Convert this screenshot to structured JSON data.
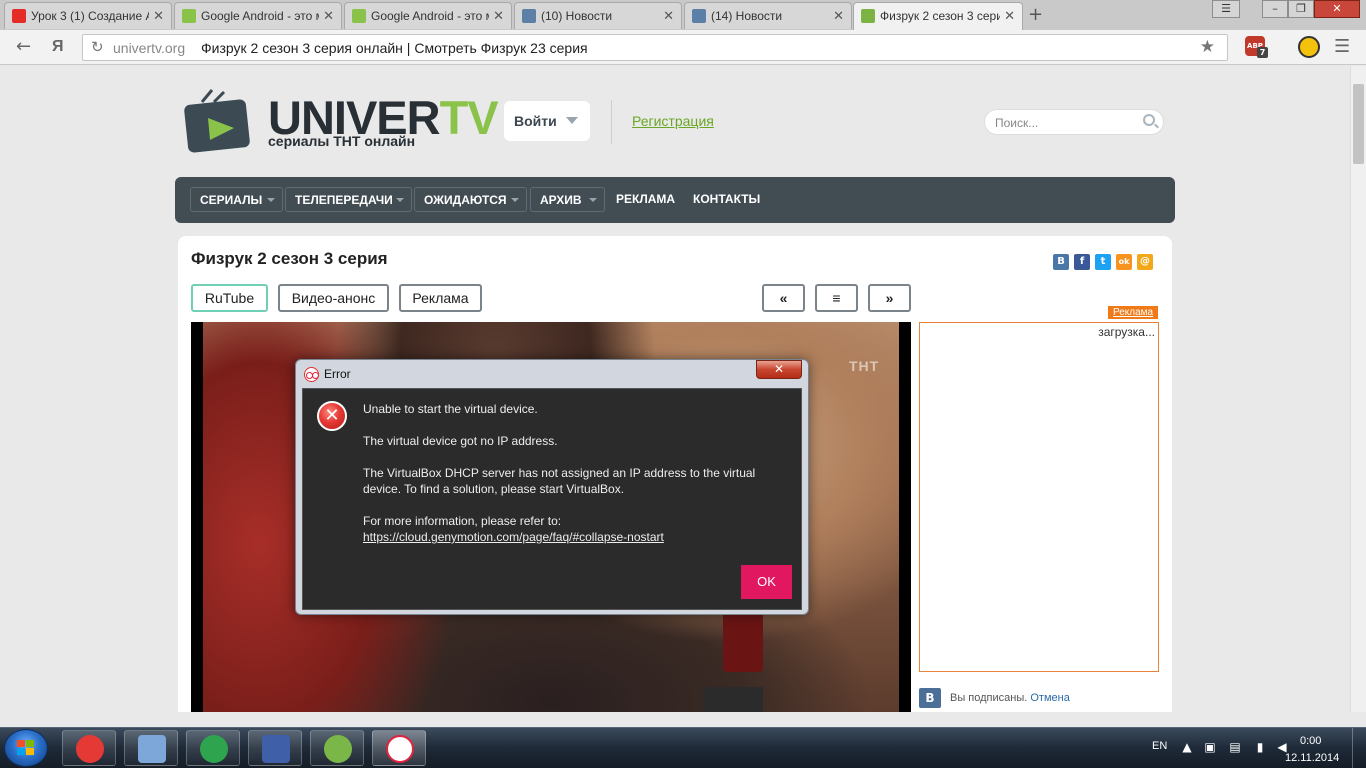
{
  "browser": {
    "tabs": [
      {
        "title": "Урок 3 (1) Создание А",
        "icon_color": "#e52d27",
        "icon": "youtube-icon"
      },
      {
        "title": "Google Android - это м",
        "icon_color": "#8bc34a",
        "icon": "android-icon"
      },
      {
        "title": "Google Android - это м",
        "icon_color": "#8bc34a",
        "icon": "android-icon"
      },
      {
        "title": "(10) Новости",
        "icon_color": "#5b7fa6",
        "icon": "pause-icon"
      },
      {
        "title": "(14) Новости",
        "icon_color": "#5b7fa6",
        "icon": "pause-icon"
      },
      {
        "title": "Физрук 2 сезон 3 сери",
        "icon_color": "#7cb342",
        "icon": "univertv-icon"
      }
    ],
    "url_domain": "univertv.org",
    "url_title": "Физрук 2 сезон 3 серия онлайн | Смотреть Физрук 23 серия",
    "yandex_letter": "Я",
    "adblock_label": "ABP",
    "adblock_count": "7"
  },
  "site": {
    "logo_main": "UNIVER",
    "logo_accent": "TV",
    "logo_sub": "сериалы ТНТ онлайн",
    "login_label": "Войти",
    "register_label": "Регистрация",
    "search_placeholder": "Поиск...",
    "menu": [
      "СЕРИАЛЫ",
      "ТЕЛЕПЕРЕДАЧИ",
      "ОЖИДАЮТСЯ",
      "АРХИВ",
      "РЕКЛАМА",
      "КОНТАКТЫ"
    ],
    "page_title": "Физрук 2 сезон 3 серия",
    "social": [
      {
        "letter": "В",
        "color": "#4a76a8",
        "icon": "vk-icon"
      },
      {
        "letter": "f",
        "color": "#3b5998",
        "icon": "facebook-icon"
      },
      {
        "letter": "t",
        "color": "#1da1f2",
        "icon": "twitter-icon"
      },
      {
        "letter": "ok",
        "color": "#f7931e",
        "icon": "odnoklassniki-icon"
      },
      {
        "letter": "@",
        "color": "#f2a818",
        "icon": "mailru-icon"
      }
    ],
    "player_tabs": [
      "RuTube",
      "Видео-анонс",
      "Реклама"
    ],
    "episode_nav": {
      "prev": "«",
      "list": "≡",
      "next": "»"
    },
    "channel_logo": "ТНТ",
    "ad_label": "Реклама",
    "ad_loading": "загрузка...",
    "vk_badge": "В",
    "vk_subscribed": "Вы подписаны.",
    "vk_cancel": "Отмена"
  },
  "dialog": {
    "title": "Error",
    "close": "✕",
    "line1": "Unable to start the virtual device.",
    "line2": "The virtual device got no IP address.",
    "line3": "The VirtualBox DHCP server has not assigned an IP address to the virtual device. To find a solution, please start VirtualBox.",
    "line4": "For more information, please refer to:",
    "link": "https://cloud.genymotion.com/page/faq/#collapse-nostart",
    "ok": "OK"
  },
  "taskbar": {
    "language": "EN",
    "time": "0:00",
    "date": "12.11.2014",
    "pinned": [
      {
        "name": "yandex-browser",
        "color": "#e53935"
      },
      {
        "name": "calculator",
        "color": "#7da7d9"
      },
      {
        "name": "mail-agent",
        "color": "#2ea44f"
      },
      {
        "name": "floppy-save",
        "color": "#3f5fa8"
      },
      {
        "name": "brackets-editor",
        "color": "#7ab648"
      },
      {
        "name": "genymotion",
        "color": "#ffffff"
      }
    ]
  }
}
